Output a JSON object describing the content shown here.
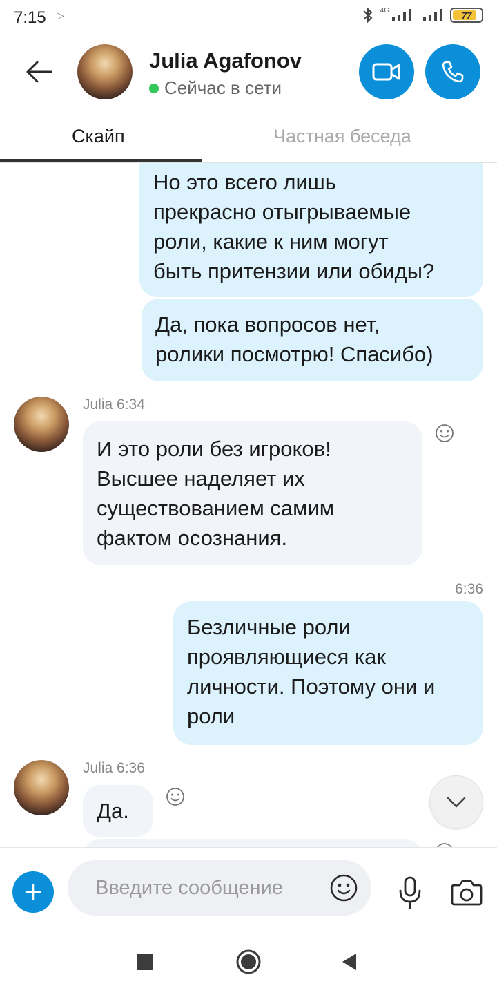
{
  "status_bar": {
    "time": "7:15",
    "network": "4G",
    "battery": "77"
  },
  "header": {
    "contact_name": "Julia Agafonov",
    "presence": "Сейчас в сети"
  },
  "tabs": [
    {
      "label": "Скайп",
      "active": true
    },
    {
      "label": "Частная беседа",
      "active": false
    }
  ],
  "messages": {
    "out1": {
      "lines": [
        "Но это всего лишь",
        "прекрасно отыгрываемые",
        "роли, какие к ним могут",
        "быть притензии или обиды?"
      ]
    },
    "out2": {
      "lines": [
        "Да, пока вопросов нет,",
        "ролики посмотрю! Спасибо)"
      ]
    },
    "in1": {
      "sender": "Julia 6:34",
      "lines": [
        "И это роли без игроков!",
        "Высшее наделяет их",
        "существованием самим",
        "фактом осознания."
      ]
    },
    "out3": {
      "time": "6:36",
      "lines": [
        "Безличные роли",
        "проявляющиеся как",
        "личности. Поэтому они и",
        "роли"
      ]
    },
    "in2": {
      "sender": "Julia 6:36",
      "lines": [
        "Да."
      ]
    }
  },
  "composer": {
    "placeholder": "Введите сообщение"
  },
  "colors": {
    "accent": "#0a8fd8",
    "outgoing_bubble": "#dcf2fd",
    "incoming_bubble": "#f1f4f8",
    "online": "#34c759"
  },
  "icons": [
    "back-arrow-icon",
    "video-call-icon",
    "phone-icon",
    "smiley-icon",
    "chevron-down-icon",
    "plus-icon",
    "microphone-icon",
    "camera-icon"
  ]
}
